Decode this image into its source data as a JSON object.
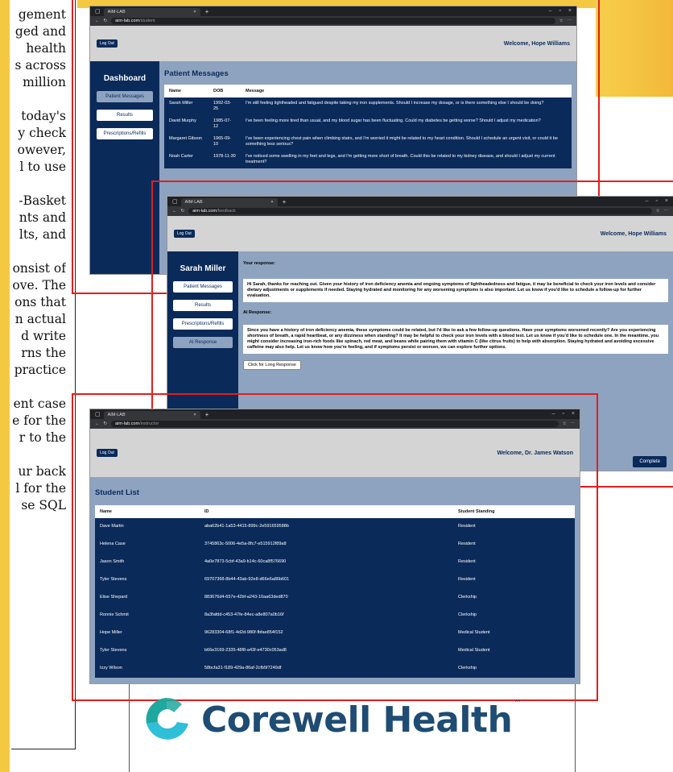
{
  "poster": {
    "left_lines": [
      "gement",
      "ged and",
      "health",
      "s across",
      "million",
      "",
      "today's",
      "y check",
      "owever,",
      "l to use",
      "",
      "-Basket",
      "nts and",
      "lts, and",
      "",
      "onsist of",
      "ove. The",
      "ons that",
      "n actual",
      "d write",
      "rns the",
      "practice",
      "",
      "ent case",
      "e for the",
      "r to the",
      "",
      "ur back",
      "l for the",
      "se SQL"
    ],
    "logo": {
      "name": "Corewell Health",
      "tm": "™",
      "colors": {
        "c_top": "#1fa8a0",
        "c_bottom": "#2fbfd9",
        "text": "#1f4c73"
      }
    }
  },
  "colors": {
    "navy": "#0a2a5a",
    "steel": "#8ea3bf",
    "red": "#e21e1e",
    "gray": "#d4d4d4"
  },
  "student_window": {
    "tab": "AIM-LAB",
    "url_host": "aim-lab.com",
    "url_path": "/student",
    "logout": "Log Out",
    "welcome": "Welcome, Hope Williams",
    "sidebar_title": "Dashboard",
    "nav": [
      "Patient Messages",
      "Results",
      "Prescriptions/Refills"
    ],
    "section_title": "Patient Messages",
    "columns": [
      "Name",
      "DOB",
      "Message"
    ],
    "rows": [
      [
        "Sarah Miller",
        "1992-03-25",
        "I'm still feeling lightheaded and fatigued despite taking my iron supplements. Should I increase my dosage, or is there something else I should be doing?"
      ],
      [
        "David Murphy",
        "1985-07-12",
        "I've been feeling more tired than usual, and my blood sugar has been fluctuating. Could my diabetes be getting worse? Should I adjust my medication?"
      ],
      [
        "Margaret Gibson",
        "1965-09-10",
        "I've been experiencing chest pain when climbing stairs, and I'm worried it might be related to my heart condition. Should I schedule an urgent visit, or could it be something less serious?"
      ],
      [
        "Noah Carter",
        "1978-11-30",
        "I've noticed some swelling in my feet and legs, and I'm getting more short of breath. Could this be related to my kidney disease, and should I adjust my current treatment?"
      ]
    ]
  },
  "feedback_window": {
    "tab": "AIM-LAB",
    "url_host": "aim-lab.com",
    "url_path": "/feedback",
    "logout": "Log Out",
    "welcome": "Welcome, Hope Williams",
    "sidebar_title": "Sarah Miller",
    "nav": [
      "Patient Messages",
      "Results",
      "Prescriptions/Refills",
      "AI Response"
    ],
    "your_response_label": "Your response:",
    "your_response": "Hi Sarah, thanks for reaching out. Given your history of iron deficiency anemia and ongoing symptoms of lightheadedness and fatigue, it may be beneficial to check your iron levels and consider dietary adjustments or supplements if needed. Staying hydrated and monitoring for any worsening symptoms is also important. Let us know if you'd like to schedule a follow-up for further evaluation.",
    "ai_response_label": "AI Response:",
    "ai_response": "Since you have a history of iron deficiency anemia, these symptoms could be related, but I'd like to ask a few follow-up questions. Have your symptoms worsened recently? Are you experiencing shortness of breath, a rapid heartbeat, or any dizziness when standing? It may be helpful to check your iron levels with a blood test. Let us know if you'd like to schedule one. In the meantime, you might consider increasing iron-rich foods like spinach, red meat, and beans while pairing them with vitamin C (like citrus fruits) to help with absorption. Staying hydrated and avoiding excessive caffeine may also help. Let us know how you're feeling, and if symptoms persist or worsen, we can explore further options.",
    "long_response_button": "Click for Long Response",
    "complete_button": "Complete"
  },
  "instructor_window": {
    "tab": "AIM-LAB",
    "url_host": "aim-lab.com",
    "url_path": "/instructor",
    "logout": "Log Out",
    "welcome": "Welcome, Dr. James Watson",
    "section_title": "Student List",
    "columns": [
      "Name",
      "ID",
      "Student Standing"
    ],
    "rows": [
      [
        "Dave Martin",
        "aba62b41-1a53-4415-899c-2e591659588b",
        "Resident"
      ],
      [
        "Helena Case",
        "3745863c-5006-4e5a-8fc7-e515912f89a8",
        "Resident"
      ],
      [
        "Jason Smith",
        "4a0e7873-5cbf-43a9-b14c-60ca8f576690",
        "Resident"
      ],
      [
        "Tyler Stevens",
        "69707368-8b44-43ab-92e8-d66e6a86b601",
        "Resident"
      ],
      [
        "Elise Shepard",
        "883676d4-657e-42bf-a243-10aa63ded870",
        "Clerkship"
      ],
      [
        "Ronnie Schmit",
        "8a3fafdd-c453-47fe-84ec-a8e807a0b16f",
        "Clerkship"
      ],
      [
        "Hope Miller",
        "96283304-68f1-4d2d-980f-fbfae854f152",
        "Medical Student"
      ],
      [
        "Tyler Stevens",
        "b66e3169-2335-48f8-a43f-e4730c053ad8",
        "Medical Student"
      ],
      [
        "Izzy Wilson",
        "58bcfa31-f189-429a-86af-2cfb5f7249df",
        "Clerkship"
      ]
    ]
  }
}
